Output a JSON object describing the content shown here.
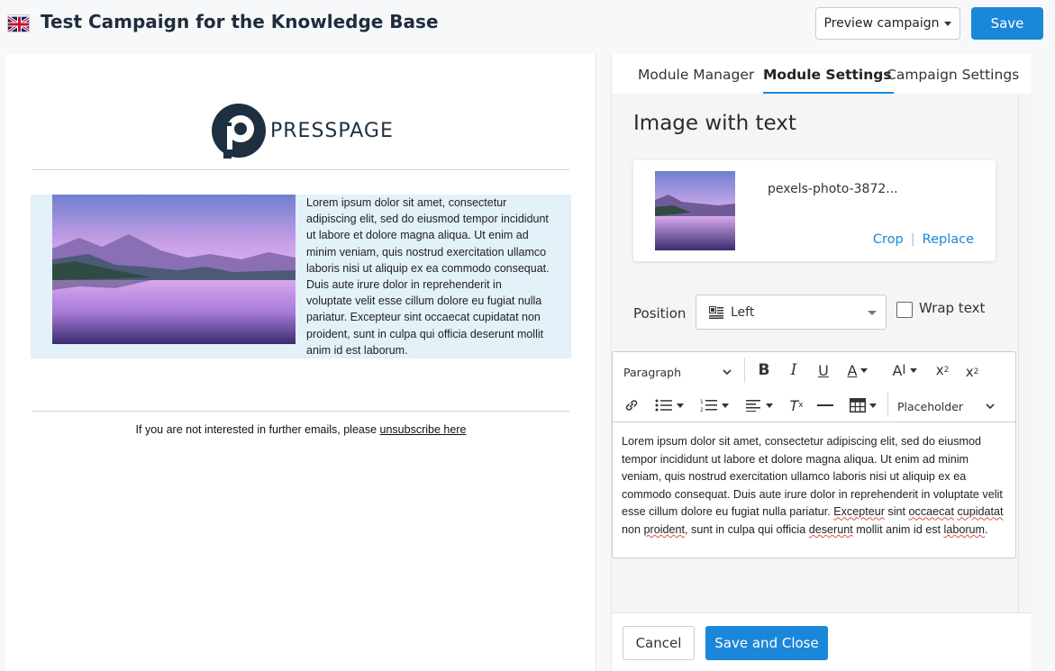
{
  "header": {
    "title": "Test Campaign for the Knowledge Base",
    "preview_label": "Preview campaign",
    "save_label": "Save"
  },
  "preview": {
    "logo_text": "PRESSPAGE",
    "body_text": "Lorem ipsum dolor sit amet, consectetur adipiscing elit, sed do eiusmod tempor incididunt ut labore et dolore magna aliqua. Ut enim ad minim veniam, quis nostrud exercitation ullamco laboris nisi ut aliquip ex ea commodo consequat. Duis aute irure dolor in reprehenderit in voluptate velit esse cillum dolore eu fugiat nulla pariatur. Excepteur sint occaecat cupidatat non proident, sunt in culpa qui officia deserunt mollit anim id est laborum.",
    "footer_text": "If you are not interested in further emails, please ",
    "footer_link": "unsubscribe here"
  },
  "tabs": {
    "module_manager": "Module Manager",
    "module_settings": "Module Settings",
    "campaign_settings": "Campaign Settings"
  },
  "settings": {
    "module_title": "Image with text",
    "image_filename": "pexels-photo-3872...",
    "crop_label": "Crop",
    "replace_label": "Replace",
    "position_label": "Position",
    "position_value": "Left",
    "wrap_label": "Wrap text"
  },
  "editor": {
    "paragraph_label": "Paragraph",
    "placeholder_label": "Placeholder",
    "text_a": "Lorem ipsum dolor sit amet, consectetur adipiscing elit, sed do eiusmod tempor incididunt ut labore et dolore magna aliqua. Ut enim ad minim veniam, quis nostrud exercitation ullamco laboris nisi ut aliquip ex ea commodo consequat. Duis aute irure dolor in reprehenderit in voluptate velit esse cillum dolore eu fugiat nulla pariatur. ",
    "w1": "Excepteur",
    "t1": " sint ",
    "w2": "occaecat",
    "t2": " ",
    "w3": "cupidatat",
    "t3": " non ",
    "w4": "proident",
    "t4": ", sunt in culpa qui officia ",
    "w5": "deserunt",
    "t5": " mollit anim id est ",
    "w6": "laborum",
    "t6": "."
  },
  "footer_buttons": {
    "cancel_label": "Cancel",
    "save_close_label": "Save and Close"
  },
  "colors": {
    "accent": "#1a87d8",
    "highlight_bg": "#e3f1f8"
  }
}
